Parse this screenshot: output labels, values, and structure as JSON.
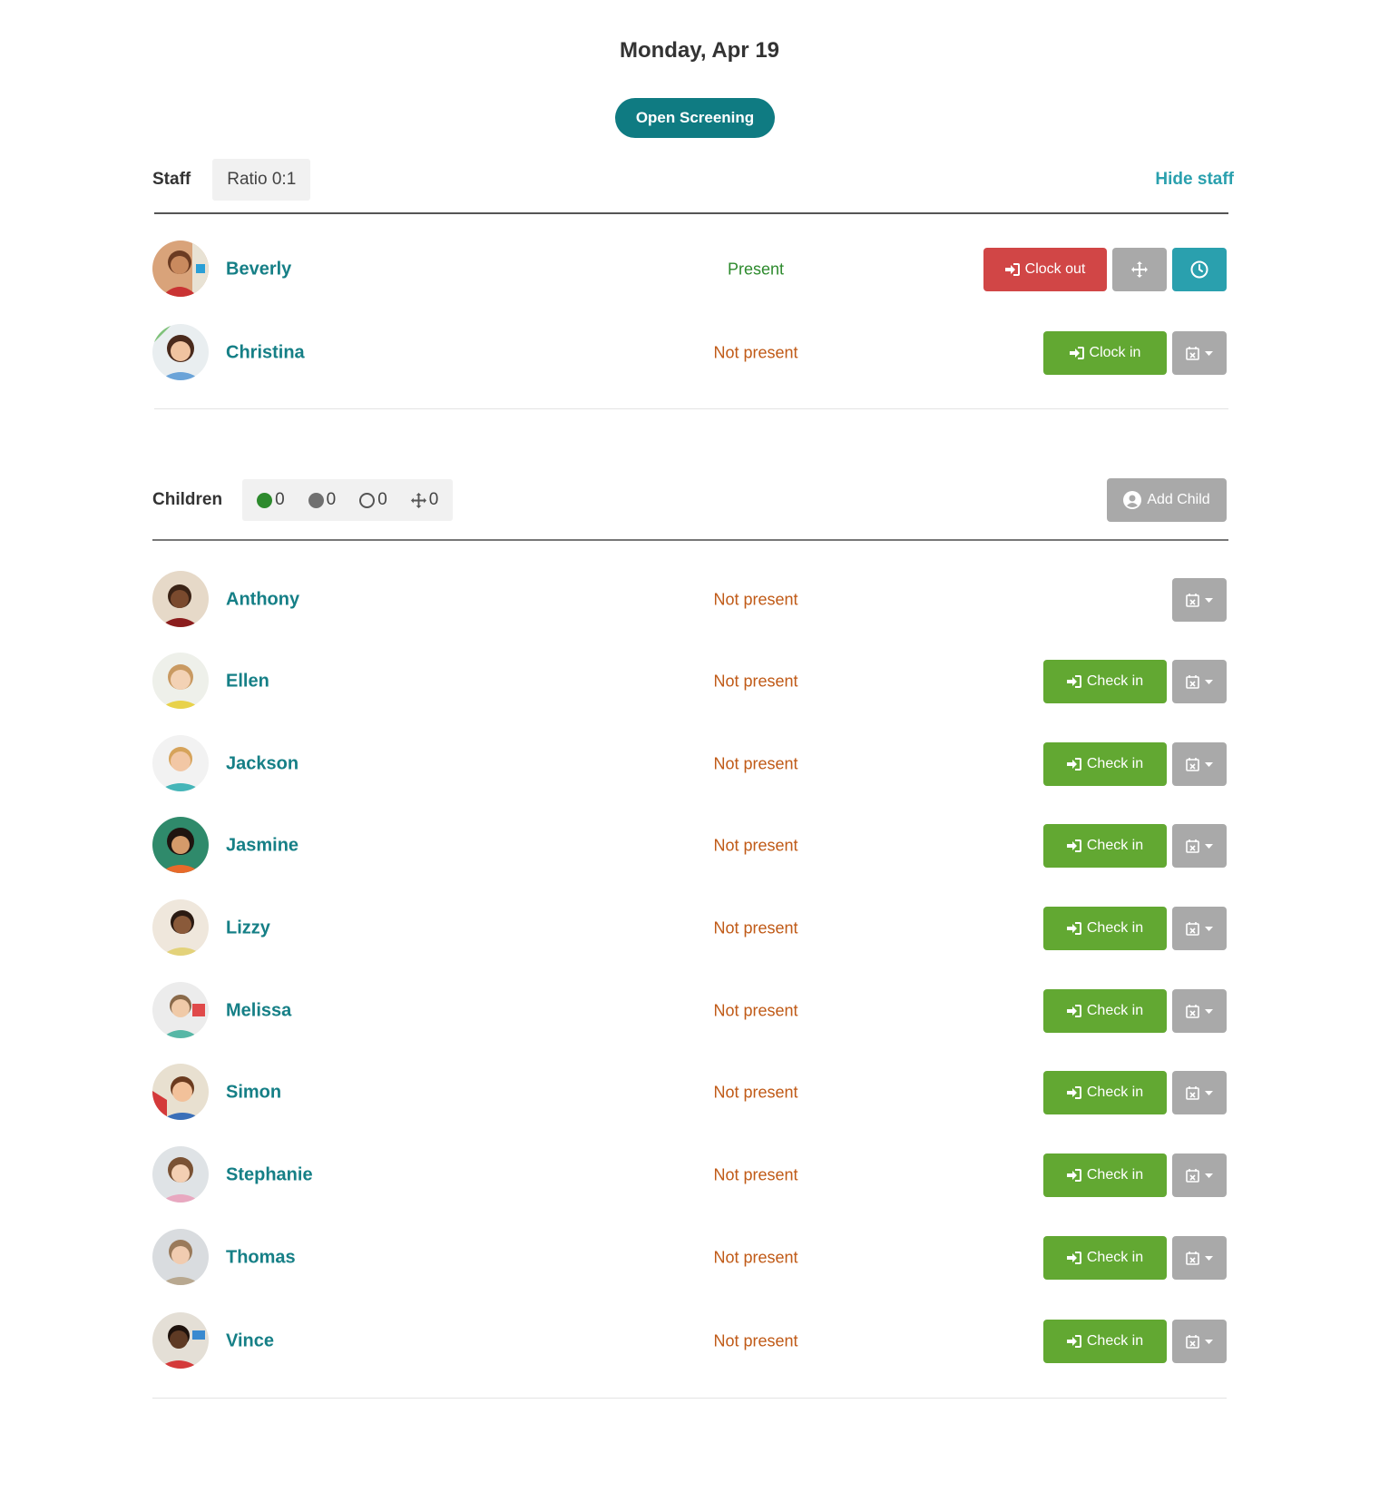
{
  "header": {
    "date": "Monday, Apr 19",
    "screening_button": "Open Screening"
  },
  "staff": {
    "label": "Staff",
    "ratio": "Ratio 0:1",
    "hide_link": "Hide staff",
    "members": [
      {
        "name": "Beverly",
        "status": "Present",
        "action": "Clock out"
      },
      {
        "name": "Christina",
        "status": "Not present",
        "action": "Clock in"
      }
    ]
  },
  "children": {
    "label": "Children",
    "counts": {
      "present": "0",
      "absent": "0",
      "not_arrived": "0",
      "moved": "0"
    },
    "add_button": "Add Child",
    "check_in_label": "Check in",
    "list": [
      {
        "name": "Anthony",
        "status": "Not present"
      },
      {
        "name": "Ellen",
        "status": "Not present"
      },
      {
        "name": "Jackson",
        "status": "Not present"
      },
      {
        "name": "Jasmine",
        "status": "Not present"
      },
      {
        "name": "Lizzy",
        "status": "Not present"
      },
      {
        "name": "Melissa",
        "status": "Not present"
      },
      {
        "name": "Simon",
        "status": "Not present"
      },
      {
        "name": "Stephanie",
        "status": "Not present"
      },
      {
        "name": "Thomas",
        "status": "Not present"
      },
      {
        "name": "Vince",
        "status": "Not present"
      }
    ]
  },
  "colors": {
    "teal": "#157f86",
    "green": "#62a832",
    "red": "#d14646",
    "grey": "#a9a9a9",
    "present": "#2d8a2d",
    "absent": "#c05a17"
  },
  "icons": {
    "clock_action": "sign-in-icon",
    "move": "move-arrows-icon",
    "time": "clock-icon",
    "calendar": "calendar-x-icon",
    "caret": "caret-down-icon",
    "add_child": "user-circle-icon"
  }
}
